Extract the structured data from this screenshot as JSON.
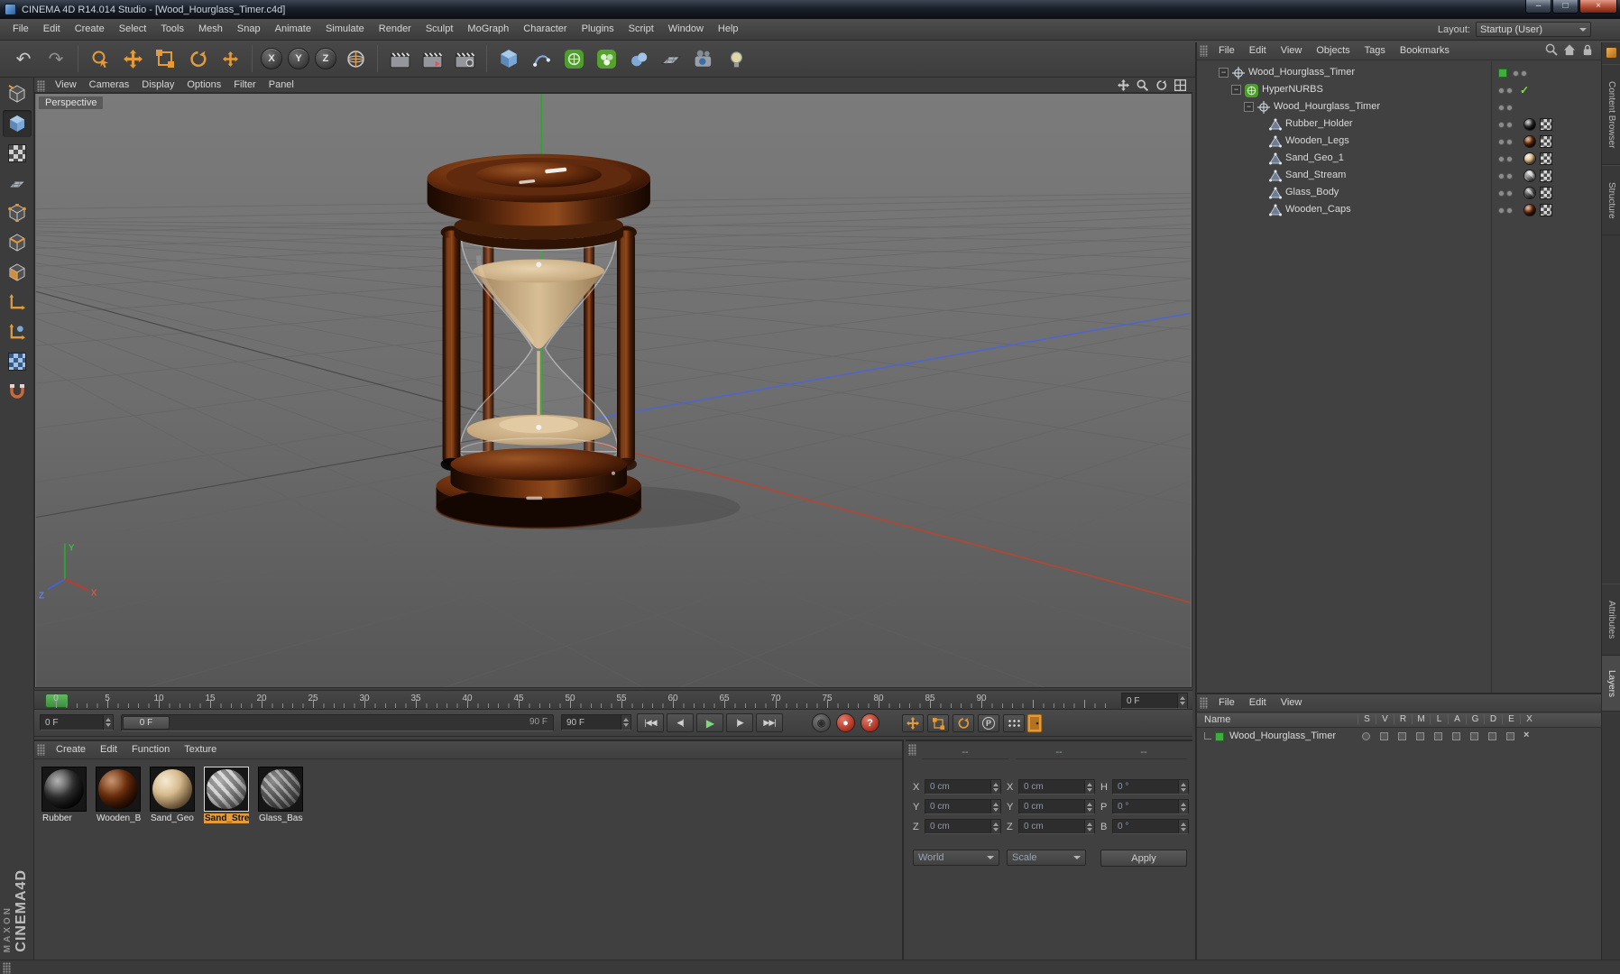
{
  "window": {
    "title": "CINEMA 4D R14.014 Studio - [Wood_Hourglass_Timer.c4d]",
    "controls": {
      "minimize": "–",
      "maximize": "□",
      "close": "×"
    }
  },
  "menubar": {
    "items": [
      "File",
      "Edit",
      "Create",
      "Select",
      "Tools",
      "Mesh",
      "Snap",
      "Animate",
      "Simulate",
      "Render",
      "Sculpt",
      "MoGraph",
      "Character",
      "Plugins",
      "Script",
      "Window",
      "Help"
    ],
    "layout_label": "Layout:",
    "layout_value": "Startup (User)"
  },
  "toolbar": {
    "axis_x": "X",
    "axis_y": "Y",
    "axis_z": "Z"
  },
  "viewport": {
    "menu": [
      "View",
      "Cameras",
      "Display",
      "Options",
      "Filter",
      "Panel"
    ],
    "label": "Perspective",
    "gizmo_x": "X",
    "gizmo_y": "Y",
    "gizmo_z": "Z"
  },
  "timeline": {
    "ticks": [
      "0",
      "5",
      "10",
      "15",
      "20",
      "25",
      "30",
      "35",
      "40",
      "45",
      "50",
      "55",
      "60",
      "65",
      "70",
      "75",
      "80",
      "85",
      "90"
    ],
    "frame_field": "0 F",
    "start_field": "0 F",
    "slider_handle": "0 F",
    "slider_end": "90 F",
    "end_field": "90 F",
    "transport": [
      {
        "name": "goto-start",
        "glyph": "|◀◀"
      },
      {
        "name": "prev-frame",
        "glyph": "◀|"
      },
      {
        "name": "play",
        "glyph": "▶"
      },
      {
        "name": "next-frame",
        "glyph": "|▶"
      },
      {
        "name": "goto-end",
        "glyph": "▶▶|"
      }
    ],
    "help_glyph": "?",
    "param_glyph": "P"
  },
  "materials": {
    "menu": [
      "Create",
      "Edit",
      "Function",
      "Texture"
    ],
    "items": [
      {
        "name": "Rubber"
      },
      {
        "name": "Wooden_B"
      },
      {
        "name": "Sand_Geo"
      },
      {
        "name": "Sand_Strea"
      },
      {
        "name": "Glass_Base"
      }
    ]
  },
  "coordinates": {
    "headers": [
      "--",
      "--",
      "--"
    ],
    "position": {
      "rows": [
        {
          "label": "X",
          "value": "0 cm"
        },
        {
          "label": "Y",
          "value": "0 cm"
        },
        {
          "label": "Z",
          "value": "0 cm"
        }
      ]
    },
    "size": {
      "rows": [
        {
          "label": "X",
          "value": "0 cm"
        },
        {
          "label": "Y",
          "value": "0 cm"
        },
        {
          "label": "Z",
          "value": "0 cm"
        }
      ]
    },
    "rotation": {
      "rows": [
        {
          "label": "H",
          "value": "0 °"
        },
        {
          "label": "P",
          "value": "0 °"
        },
        {
          "label": "B",
          "value": "0 °"
        }
      ]
    },
    "dropdown_left": "World",
    "dropdown_right": "Scale",
    "apply_label": "Apply"
  },
  "object_manager": {
    "menu": [
      "File",
      "Edit",
      "View",
      "Objects",
      "Tags",
      "Bookmarks"
    ],
    "tree": [
      {
        "name": "Wood_Hourglass_Timer"
      },
      {
        "name": "HyperNURBS"
      },
      {
        "name": "Wood_Hourglass_Timer"
      },
      {
        "name": "Rubber_Holder"
      },
      {
        "name": "Wooden_Legs"
      },
      {
        "name": "Sand_Geo_1"
      },
      {
        "name": "Sand_Stream"
      },
      {
        "name": "Glass_Body"
      },
      {
        "name": "Wooden_Caps"
      }
    ],
    "check_glyph": "✓"
  },
  "layers_panel": {
    "menu": [
      "File",
      "Edit",
      "View"
    ],
    "name_header": "Name",
    "columns": [
      "S",
      "V",
      "R",
      "M",
      "L",
      "A",
      "G",
      "D",
      "E",
      "X"
    ],
    "row_name": "Wood_Hourglass_Timer",
    "delete_glyph": "×"
  },
  "side_tabs": {
    "content_browser": "Content Browser",
    "structure": "Structure",
    "attributes": "Attributes",
    "layers": "Layers"
  },
  "branding": {
    "maxon": "MAXON",
    "cinema": "CINEMA4D"
  },
  "icons": {
    "undo": "↶",
    "redo": "↷",
    "expander": "−"
  }
}
